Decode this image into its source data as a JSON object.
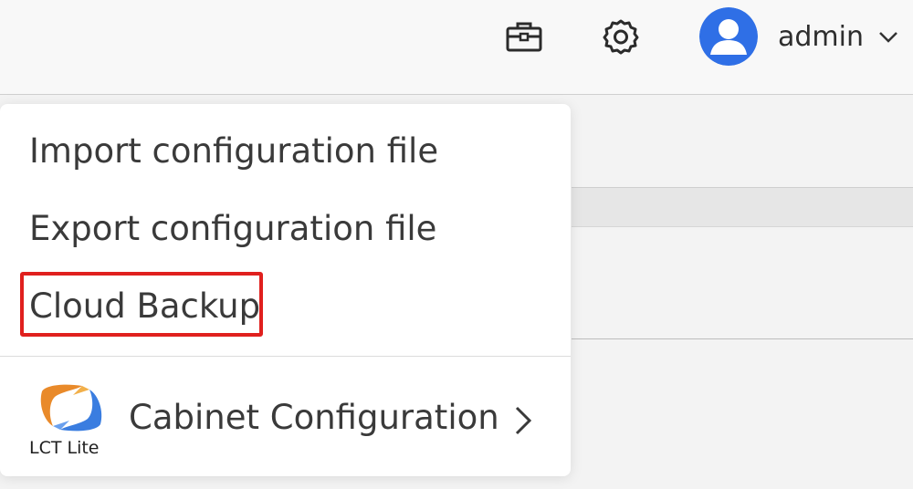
{
  "header": {
    "toolbox_icon": "toolbox-icon",
    "settings_icon": "gear-icon",
    "user": {
      "avatar_icon": "user-avatar-icon",
      "name": "admin",
      "dropdown_icon": "chevron-down-icon"
    }
  },
  "menu": {
    "items": [
      {
        "label": "Import configuration file"
      },
      {
        "label": "Export configuration file"
      },
      {
        "label": "Cloud Backup",
        "highlighted": true
      }
    ],
    "cabinet": {
      "logo_text": "LCT Lite",
      "label": "Cabinet Configuration",
      "arrow_icon": "chevron-right-icon"
    }
  },
  "colors": {
    "accent_blue": "#2f6fe6",
    "highlight_red": "#e0201e",
    "logo_orange": "#e98a2a",
    "logo_blue": "#3a7de0"
  }
}
